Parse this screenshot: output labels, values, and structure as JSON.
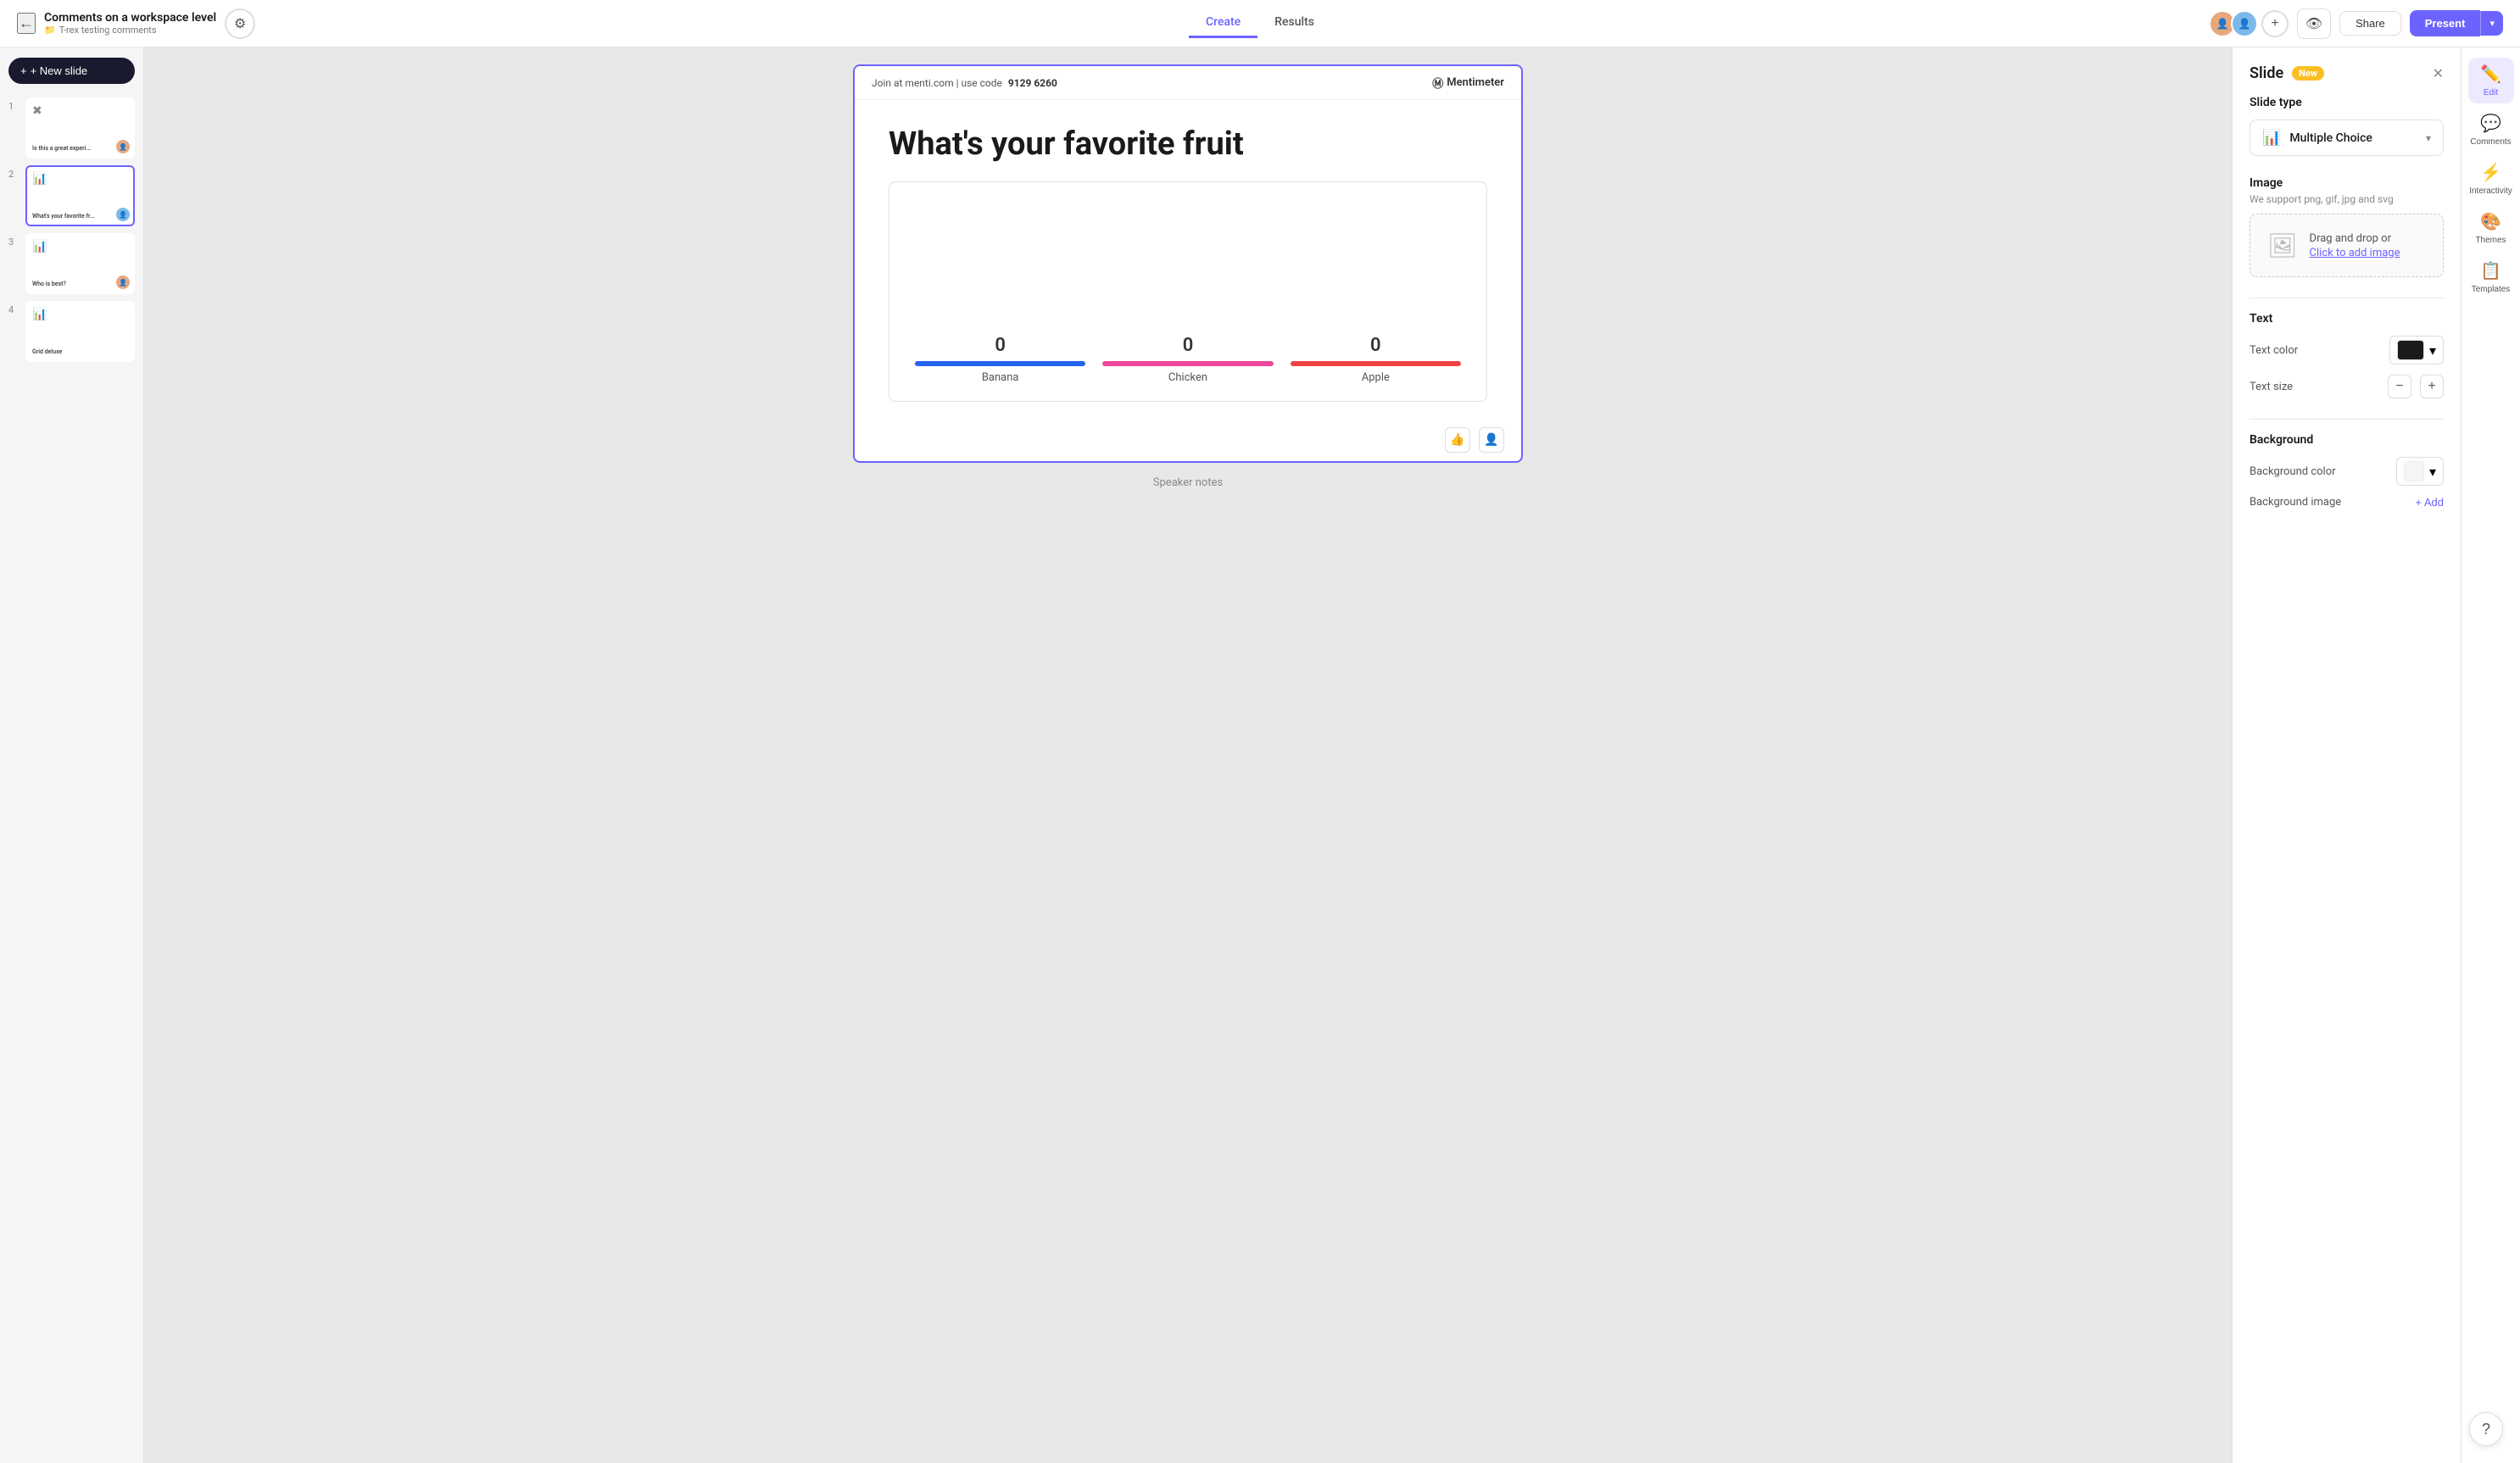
{
  "header": {
    "back_icon": "←",
    "title": "Comments on a workspace level",
    "subtitle_icon": "📁",
    "subtitle": "T-rex testing comments",
    "settings_icon": "⚙",
    "nav_tabs": [
      {
        "label": "Create",
        "active": true
      },
      {
        "label": "Results",
        "active": false
      }
    ],
    "add_icon": "+",
    "eye_icon": "👁",
    "share_label": "Share",
    "present_label": "Present",
    "present_chevron": "▾"
  },
  "sidebar": {
    "new_slide_label": "+ New slide",
    "slides": [
      {
        "number": "1",
        "title": "Is this a great experi...",
        "icon": "✖",
        "active": false
      },
      {
        "number": "2",
        "title": "What's your favorite fr...",
        "icon": "📊",
        "active": true
      },
      {
        "number": "3",
        "title": "Who is best?",
        "icon": "📊",
        "active": false
      },
      {
        "number": "4",
        "title": "Grid deluxe",
        "icon": "📊",
        "active": false
      }
    ]
  },
  "canvas": {
    "join_text": "Join at menti.com | use code",
    "join_code": "9129 6260",
    "menti_logo": "Mentimeter",
    "question": "What's your favorite fruit",
    "bars": [
      {
        "value": "0",
        "label": "Banana",
        "color": "#2563eb"
      },
      {
        "value": "0",
        "label": "Chicken",
        "color": "#ec4899"
      },
      {
        "value": "0",
        "label": "Apple",
        "color": "#ef4444"
      }
    ],
    "speaker_notes": "Speaker notes"
  },
  "right_panel": {
    "slide_label": "Slide",
    "new_badge": "New",
    "close_icon": "✕",
    "slide_type_label": "Slide type",
    "slide_type_icon": "📊",
    "slide_type_value": "Multiple Choice",
    "image_label": "Image",
    "image_subtitle": "We support png, gif, jpg and svg",
    "dropzone_text": "Drag and drop or",
    "dropzone_link": "Click to add image",
    "text_label": "Text",
    "text_color_label": "Text color",
    "text_size_label": "Text size",
    "text_size_minus": "−",
    "text_size_plus": "+",
    "background_label": "Background",
    "bg_color_label": "Background color",
    "bg_image_label": "Background image",
    "add_bg_label": "+ Add"
  },
  "tools": [
    {
      "icon": "✏",
      "label": "Edit",
      "active": true
    },
    {
      "icon": "💬",
      "label": "Comments",
      "active": false
    },
    {
      "icon": "⚡",
      "label": "Interactivity",
      "active": false
    },
    {
      "icon": "🎨",
      "label": "Themes",
      "active": false
    },
    {
      "icon": "📋",
      "label": "Templates",
      "active": false
    }
  ],
  "help_icon": "?"
}
